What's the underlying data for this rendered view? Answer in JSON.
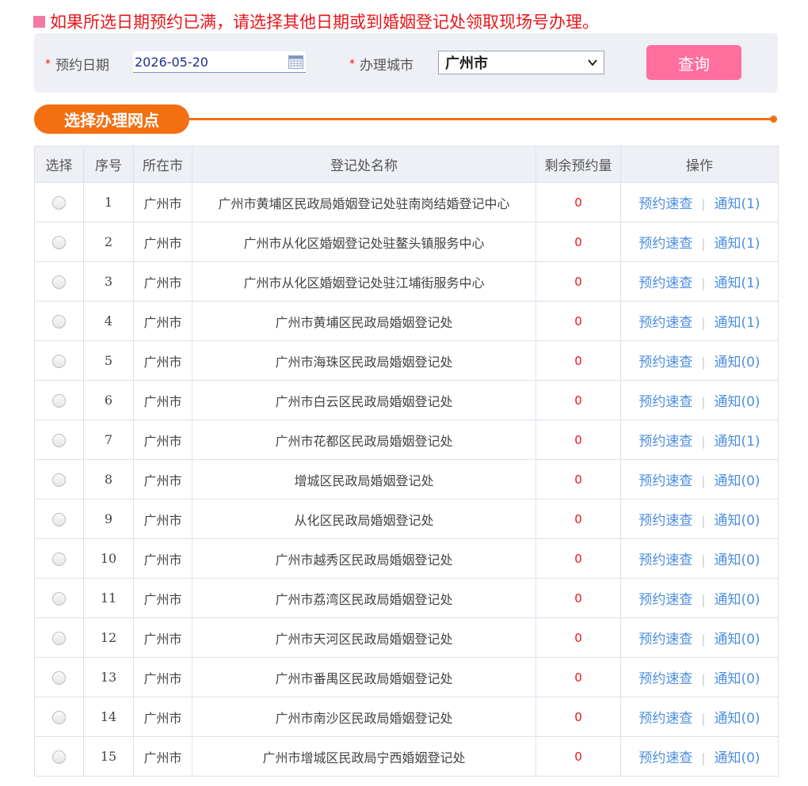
{
  "notice": {
    "text": "如果所选日期预约已满，请选择其他日期或到婚姻登记处领取现场号办理。"
  },
  "search": {
    "required_mark": "*",
    "date_label": "预约日期",
    "date_value": "2026-05-20",
    "city_label": "办理城市",
    "city_value": "广州市",
    "query_label": "查询"
  },
  "section": {
    "title": "选择办理网点"
  },
  "table": {
    "headers": {
      "select": "选择",
      "index": "序号",
      "city": "所在市",
      "name": "登记处名称",
      "remaining": "剩余预约量",
      "action": "操作"
    },
    "rows": [
      {
        "index": "1",
        "city": "广州市",
        "name": "广州市黄埔区民政局婚姻登记处驻南岗结婚登记中心",
        "remaining": "0",
        "quick": "预约速查",
        "notice": "通知(1)"
      },
      {
        "index": "2",
        "city": "广州市",
        "name": "广州市从化区婚姻登记处驻鳌头镇服务中心",
        "remaining": "0",
        "quick": "预约速查",
        "notice": "通知(1)"
      },
      {
        "index": "3",
        "city": "广州市",
        "name": "广州市从化区婚姻登记处驻江埔街服务中心",
        "remaining": "0",
        "quick": "预约速查",
        "notice": "通知(1)"
      },
      {
        "index": "4",
        "city": "广州市",
        "name": "广州市黄埔区民政局婚姻登记处",
        "remaining": "0",
        "quick": "预约速查",
        "notice": "通知(1)"
      },
      {
        "index": "5",
        "city": "广州市",
        "name": "广州市海珠区民政局婚姻登记处",
        "remaining": "0",
        "quick": "预约速查",
        "notice": "通知(0)"
      },
      {
        "index": "6",
        "city": "广州市",
        "name": "广州市白云区民政局婚姻登记处",
        "remaining": "0",
        "quick": "预约速查",
        "notice": "通知(0)"
      },
      {
        "index": "7",
        "city": "广州市",
        "name": "广州市花都区民政局婚姻登记处",
        "remaining": "0",
        "quick": "预约速查",
        "notice": "通知(1)"
      },
      {
        "index": "8",
        "city": "广州市",
        "name": "增城区民政局婚姻登记处",
        "remaining": "0",
        "quick": "预约速查",
        "notice": "通知(0)"
      },
      {
        "index": "9",
        "city": "广州市",
        "name": "从化区民政局婚姻登记处",
        "remaining": "0",
        "quick": "预约速查",
        "notice": "通知(0)"
      },
      {
        "index": "10",
        "city": "广州市",
        "name": "广州市越秀区民政局婚姻登记处",
        "remaining": "0",
        "quick": "预约速查",
        "notice": "通知(0)"
      },
      {
        "index": "11",
        "city": "广州市",
        "name": "广州市荔湾区民政局婚姻登记处",
        "remaining": "0",
        "quick": "预约速查",
        "notice": "通知(0)"
      },
      {
        "index": "12",
        "city": "广州市",
        "name": "广州市天河区民政局婚姻登记处",
        "remaining": "0",
        "quick": "预约速查",
        "notice": "通知(0)"
      },
      {
        "index": "13",
        "city": "广州市",
        "name": "广州市番禺区民政局婚姻登记处",
        "remaining": "0",
        "quick": "预约速查",
        "notice": "通知(0)"
      },
      {
        "index": "14",
        "city": "广州市",
        "name": "广州市南沙区民政局婚姻登记处",
        "remaining": "0",
        "quick": "预约速查",
        "notice": "通知(0)"
      },
      {
        "index": "15",
        "city": "广州市",
        "name": "广州市增城区民政局宁西婚姻登记处",
        "remaining": "0",
        "quick": "预约速查",
        "notice": "通知(0)"
      }
    ]
  },
  "colors": {
    "accent_orange": "#f36f12",
    "button_pink": "#ff6f9e",
    "alert_red": "#e8161b",
    "link_blue": "#4d8fe0"
  }
}
